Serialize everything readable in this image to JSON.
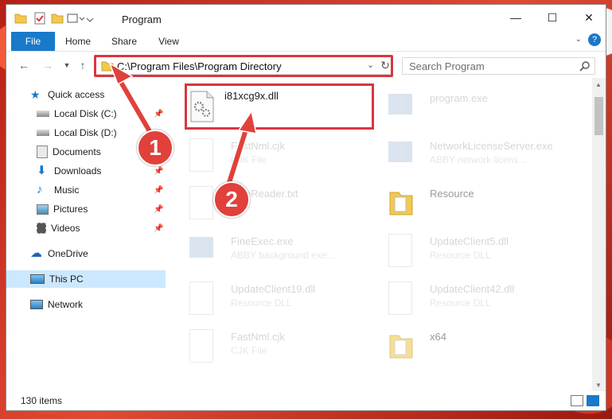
{
  "window": {
    "title": "Program"
  },
  "ribbon": {
    "tabs": [
      "File",
      "Home",
      "Share",
      "View"
    ]
  },
  "address": {
    "path": "C:\\Program Files\\Program Directory"
  },
  "search": {
    "placeholder": "Search Program"
  },
  "sidebar": {
    "items": [
      {
        "label": "Quick access",
        "icon": "star-icon"
      },
      {
        "label": "Local Disk (C:)",
        "icon": "drive-icon"
      },
      {
        "label": "Local Disk (D:)",
        "icon": "drive-icon"
      },
      {
        "label": "Documents",
        "icon": "documents-icon"
      },
      {
        "label": "Downloads",
        "icon": "download-icon"
      },
      {
        "label": "Music",
        "icon": "music-icon"
      },
      {
        "label": "Pictures",
        "icon": "pictures-icon"
      },
      {
        "label": "Videos",
        "icon": "videos-icon"
      },
      {
        "label": "OneDrive",
        "icon": "cloud-icon"
      },
      {
        "label": "This PC",
        "icon": "pc-icon"
      },
      {
        "label": "Network",
        "icon": "network-icon"
      }
    ]
  },
  "files": [
    {
      "name": "i81xcg9x.dll",
      "type": ""
    },
    {
      "name": "program.exe",
      "type": ""
    },
    {
      "name": "FastNml.cjk",
      "type": "CJK File"
    },
    {
      "name": "NetworkLicenseServer.exe",
      "type": "ABBY network licens..."
    },
    {
      "name": "FineReader.txt",
      "type": "File"
    },
    {
      "name": "Resource",
      "type": ""
    },
    {
      "name": "FineExec.exe",
      "type": "ABBY background exe..."
    },
    {
      "name": "UpdateClient5.dll",
      "type": "Resource DLL"
    },
    {
      "name": "UpdateClient19.dll",
      "type": "Resource DLL"
    },
    {
      "name": "UpdateClient42.dll",
      "type": "Resource DLL"
    },
    {
      "name": "FastNml.cjk",
      "type": "CJK File"
    },
    {
      "name": "x64",
      "type": ""
    }
  ],
  "callouts": {
    "one": "1",
    "two": "2"
  },
  "status": {
    "item_count": "130 items"
  },
  "colors": {
    "accent": "#1979ca",
    "highlight": "#d9363e",
    "selected": "#cce8ff"
  }
}
